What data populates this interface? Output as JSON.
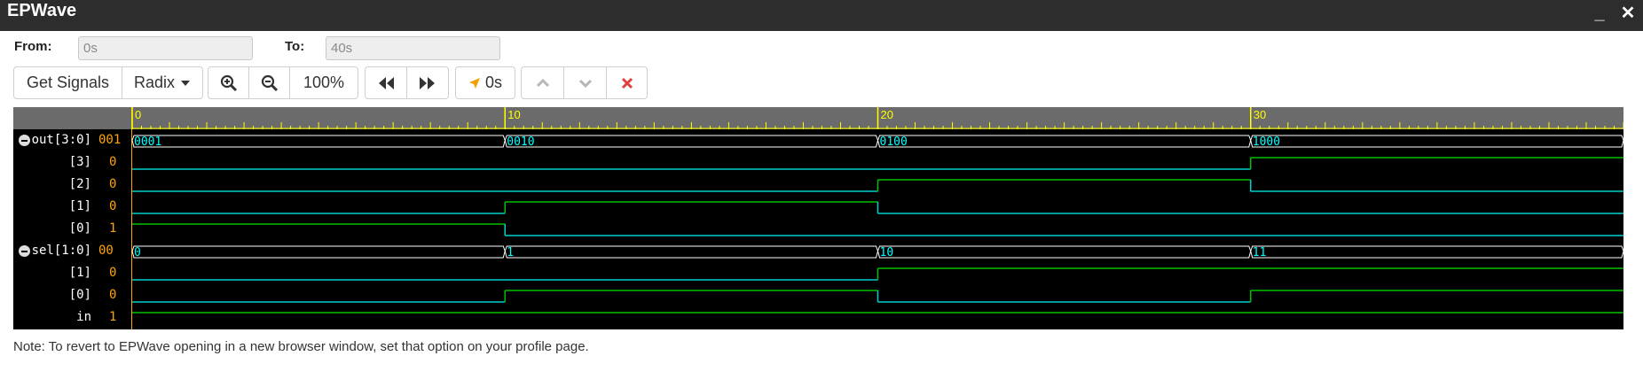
{
  "window": {
    "title": "EPWave",
    "minimize_symbol": "_",
    "close_symbol": "✕"
  },
  "range": {
    "from_label": "From:",
    "from_value": "0s",
    "to_label": "To:",
    "to_value": "40s"
  },
  "toolbar": {
    "get_signals": "Get Signals",
    "radix": "Radix",
    "zoom_level": "100%",
    "cursor_time": "0s"
  },
  "timeline": {
    "start": 0,
    "end": 40,
    "major_labels": [
      "0",
      "10",
      "20",
      "30"
    ],
    "major_values": [
      0,
      10,
      20,
      30
    ]
  },
  "signals": [
    {
      "name": "out[3:0]",
      "value": "001",
      "type": "bus",
      "collapsible": true,
      "segments": [
        {
          "t0": 0,
          "t1": 10,
          "label": "0001"
        },
        {
          "t0": 10,
          "t1": 20,
          "label": "0010"
        },
        {
          "t0": 20,
          "t1": 30,
          "label": "0100"
        },
        {
          "t0": 30,
          "t1": 40,
          "label": "1000"
        }
      ]
    },
    {
      "name": "[3]",
      "value": "0",
      "type": "bit",
      "transitions": [
        {
          "t": 0,
          "v": 0
        },
        {
          "t": 30,
          "v": 1
        }
      ]
    },
    {
      "name": "[2]",
      "value": "0",
      "type": "bit",
      "transitions": [
        {
          "t": 0,
          "v": 0
        },
        {
          "t": 20,
          "v": 1
        },
        {
          "t": 30,
          "v": 0
        }
      ]
    },
    {
      "name": "[1]",
      "value": "0",
      "type": "bit",
      "transitions": [
        {
          "t": 0,
          "v": 0
        },
        {
          "t": 10,
          "v": 1
        },
        {
          "t": 20,
          "v": 0
        }
      ]
    },
    {
      "name": "[0]",
      "value": "1",
      "type": "bit",
      "transitions": [
        {
          "t": 0,
          "v": 1
        },
        {
          "t": 10,
          "v": 0
        }
      ]
    },
    {
      "name": "sel[1:0]",
      "value": "00",
      "type": "bus",
      "collapsible": true,
      "segments": [
        {
          "t0": 0,
          "t1": 10,
          "label": "0"
        },
        {
          "t0": 10,
          "t1": 20,
          "label": "1"
        },
        {
          "t0": 20,
          "t1": 30,
          "label": "10"
        },
        {
          "t0": 30,
          "t1": 40,
          "label": "11"
        }
      ]
    },
    {
      "name": "[1]",
      "value": "0",
      "type": "bit",
      "transitions": [
        {
          "t": 0,
          "v": 0
        },
        {
          "t": 20,
          "v": 1
        }
      ]
    },
    {
      "name": "[0]",
      "value": "0",
      "type": "bit",
      "transitions": [
        {
          "t": 0,
          "v": 0
        },
        {
          "t": 10,
          "v": 1
        },
        {
          "t": 20,
          "v": 0
        },
        {
          "t": 30,
          "v": 1
        }
      ]
    },
    {
      "name": "in",
      "value": "1",
      "type": "bit",
      "transitions": [
        {
          "t": 0,
          "v": 1
        }
      ]
    }
  ],
  "colors": {
    "high": "#00c000",
    "low": "#00d0d0",
    "bus_outline": "#ffffff",
    "bus_text": "#00ffff",
    "ruler_tick": "#ffff00",
    "value_text": "#ffa500",
    "close_red": "#e04040",
    "cursor_icon": "#f0a000"
  },
  "note": "Note: To revert to EPWave opening in a new browser window, set that option on your profile page."
}
